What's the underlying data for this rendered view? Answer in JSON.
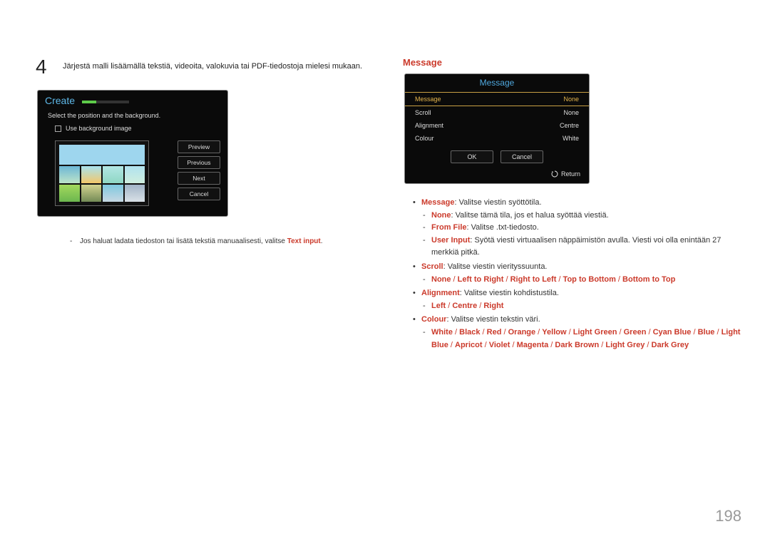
{
  "step": {
    "number": "4",
    "text": "Järjestä malli lisäämällä tekstiä, videoita, valokuvia tai PDF-tiedostoja mielesi mukaan."
  },
  "createPanel": {
    "title": "Create",
    "subtitle": "Select the position and the background.",
    "checkbox": "Use background image",
    "buttons": {
      "preview": "Preview",
      "previous": "Previous",
      "next": "Next",
      "cancel": "Cancel"
    }
  },
  "leftFootnote": {
    "pre": "Jos haluat ladata tiedoston tai lisätä tekstiä manuaalisesti, valitse ",
    "bold": "Text input",
    "post": "."
  },
  "right": {
    "heading": "Message",
    "panel": {
      "title": "Message",
      "rows": {
        "messageLabel": "Message",
        "messageValue": "None",
        "scrollLabel": "Scroll",
        "scrollValue": "None",
        "alignLabel": "Alignment",
        "alignValue": "Centre",
        "colourLabel": "Colour",
        "colourValue": "White"
      },
      "ok": "OK",
      "cancel": "Cancel",
      "return": "Return"
    },
    "bullets": {
      "msg": {
        "label": "Message",
        "rest": ": Valitse viestin syöttötila."
      },
      "none": {
        "label": "None",
        "rest": ": Valitse tämä tila, jos et halua syöttää viestiä."
      },
      "fromFile": {
        "label": "From File",
        "rest": ": Valitse .txt-tiedosto."
      },
      "userInput": {
        "label": "User Input",
        "rest": ": Syötä viesti virtuaalisen näppäimistön avulla. Viesti voi olla enintään 27 merkkiä pitkä."
      },
      "scroll": {
        "label": "Scroll",
        "rest": ": Valitse viestin vierityssuunta."
      },
      "scrollOpts": {
        "a": "None",
        "b": "Left to Right",
        "c": "Right to Left",
        "d": "Top to Bottom",
        "e": "Bottom to Top"
      },
      "align": {
        "label": "Alignment",
        "rest": ": Valitse viestin kohdistustila."
      },
      "alignOpts": {
        "a": "Left",
        "b": "Centre",
        "c": "Right"
      },
      "colour": {
        "label": "Colour",
        "rest": ": Valitse viestin tekstin väri."
      },
      "colourOpts": {
        "a": "White",
        "b": "Black",
        "c": "Red",
        "d": "Orange",
        "e": "Yellow",
        "f": "Light Green",
        "g": "Green",
        "h": "Cyan Blue",
        "i": "Blue",
        "j": "Light Blue",
        "k": "Apricot",
        "l": "Violet",
        "m": "Magenta",
        "n": "Dark Brown",
        "o": "Light Grey",
        "p": "Dark Grey"
      }
    }
  },
  "sep": " / ",
  "pageNumber": "198"
}
